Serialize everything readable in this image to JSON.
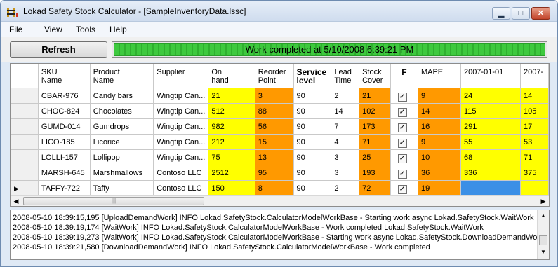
{
  "window": {
    "title": "Lokad Safety Stock Calculator - [SampleInventoryData.lssc]",
    "min_glyph": "▁",
    "max_glyph": "□",
    "close_glyph": "✕"
  },
  "menu": {
    "file": "File",
    "view": "View",
    "tools": "Tools",
    "help": "Help"
  },
  "toolbar": {
    "refresh_label": "Refresh",
    "status": "Work completed at 5/10/2008 6:39:21 PM",
    "progress_fraction": 1.0
  },
  "grid": {
    "headers": {
      "sku": "SKU\nName",
      "product": "Product\nName",
      "supplier": "Supplier",
      "onhand": "On\nhand",
      "reorder": "Reorder\nPoint",
      "service": "Service\nlevel",
      "lead": "Lead\nTime",
      "cover": "Stock\nCover",
      "f": "F",
      "mape": "MAPE",
      "d1": "2007-01-01",
      "d2": "2007-"
    },
    "rows": [
      {
        "sku": "CBAR-976",
        "product": "Candy bars",
        "supplier": "Wingtip Can...",
        "onhand": "21",
        "reorder": "3",
        "service": "90",
        "lead": "2",
        "cover": "21",
        "f": "✓",
        "mape": "9",
        "d1": "24",
        "d2": "14"
      },
      {
        "sku": "CHOC-824",
        "product": "Chocolates",
        "supplier": "Wingtip Can...",
        "onhand": "512",
        "reorder": "88",
        "service": "90",
        "lead": "14",
        "cover": "102",
        "f": "✓",
        "mape": "14",
        "d1": "115",
        "d2": "105"
      },
      {
        "sku": "GUMD-014",
        "product": "Gumdrops",
        "supplier": "Wingtip Can...",
        "onhand": "982",
        "reorder": "56",
        "service": "90",
        "lead": "7",
        "cover": "173",
        "f": "✓",
        "mape": "16",
        "d1": "291",
        "d2": "17"
      },
      {
        "sku": "LICO-185",
        "product": "Licorice",
        "supplier": "Wingtip Can...",
        "onhand": "212",
        "reorder": "15",
        "service": "90",
        "lead": "4",
        "cover": "71",
        "f": "✓",
        "mape": "9",
        "d1": "55",
        "d2": "53"
      },
      {
        "sku": "LOLLI-157",
        "product": "Lollipop",
        "supplier": "Wingtip Can...",
        "onhand": "75",
        "reorder": "13",
        "service": "90",
        "lead": "3",
        "cover": "25",
        "f": "✓",
        "mape": "10",
        "d1": "68",
        "d2": "71"
      },
      {
        "sku": "MARSH-645",
        "product": "Marshmallows",
        "supplier": "Contoso LLC",
        "onhand": "2512",
        "reorder": "95",
        "service": "90",
        "lead": "3",
        "cover": "193",
        "f": "✓",
        "mape": "36",
        "d1": "336",
        "d2": "375"
      },
      {
        "sku": "TAFFY-722",
        "product": "Taffy",
        "supplier": "Contoso LLC",
        "onhand": "150",
        "reorder": "8",
        "service": "90",
        "lead": "2",
        "cover": "72",
        "f": "✓",
        "mape": "19",
        "d1": "",
        "d2": ""
      }
    ],
    "current_row_marker": "▶",
    "scroll_left": "◀",
    "scroll_right": "▶",
    "scroll_grip": "|||"
  },
  "log": {
    "lines": [
      "2008-05-10 18:39:15,195 [UploadDemandWork] INFO  Lokad.SafetyStock.CalculatorModelWorkBase - Starting work async Lokad.SafetyStock.WaitWork",
      "2008-05-10 18:39:19,174 [WaitWork] INFO  Lokad.SafetyStock.CalculatorModelWorkBase - Work completed Lokad.SafetyStock.WaitWork",
      "2008-05-10 18:39:19,273 [WaitWork] INFO  Lokad.SafetyStock.CalculatorModelWorkBase - Starting work async Lokad.SafetyStock.DownloadDemandWork",
      "2008-05-10 18:39:21,580 [DownloadDemandWork] INFO  Lokad.SafetyStock.CalculatorModelWorkBase - Work completed"
    ],
    "scroll_up": "▲",
    "scroll_down": "▼"
  },
  "colors": {
    "onhand": "#ffff00",
    "reorder": "#ff9900",
    "selected_cell": "#3b8fe6",
    "progress": "#2fb02f"
  },
  "icons": {
    "app": "ladder-icon",
    "check": "checkbox-icon"
  }
}
